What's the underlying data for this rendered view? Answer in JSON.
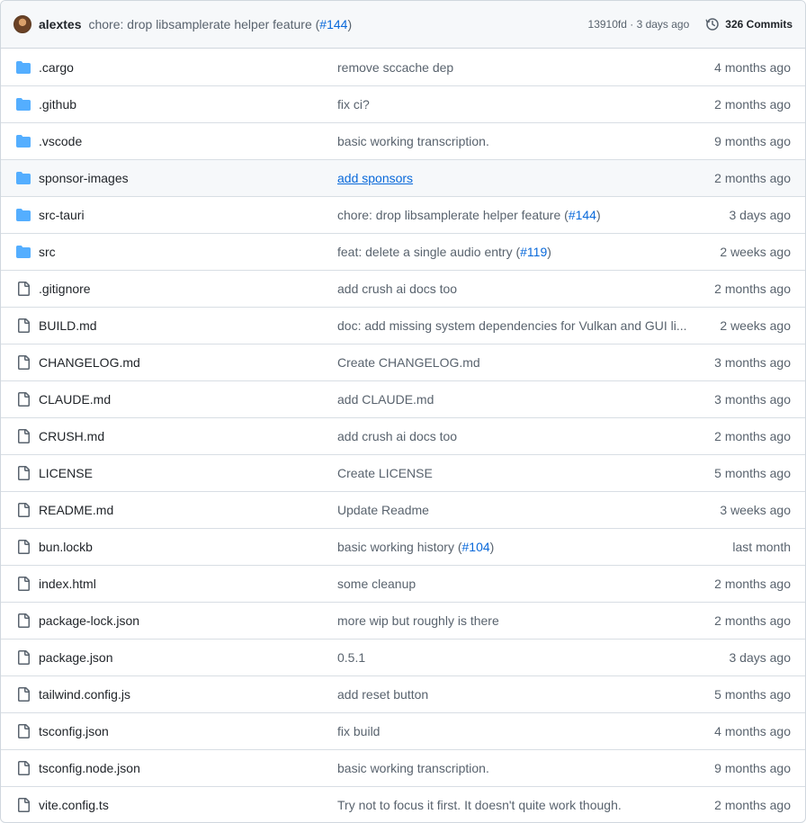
{
  "latest_commit": {
    "author": "alextes",
    "message": "chore: drop libsamplerate helper feature (",
    "pr": "#144",
    "message_end": ")",
    "meta": "13910fd · 3 days ago",
    "commits_label": "326 Commits"
  },
  "colors": {
    "folder": "#54aeff",
    "link": "#0969da",
    "muted": "#59636e"
  },
  "files": [
    {
      "name": ".cargo",
      "type": "folder",
      "msg": "remove sccache dep",
      "pr": "",
      "msg_end": "",
      "time": "4 months ago"
    },
    {
      "name": ".github",
      "type": "folder",
      "msg": "fix ci?",
      "pr": "",
      "msg_end": "",
      "time": "2 months ago"
    },
    {
      "name": ".vscode",
      "type": "folder",
      "msg": "basic working transcription.",
      "pr": "",
      "msg_end": "",
      "time": "9 months ago"
    },
    {
      "name": "sponsor-images",
      "type": "folder",
      "msg": "add sponsors",
      "pr": "",
      "msg_end": "",
      "time": "2 months ago",
      "hover": true
    },
    {
      "name": "src-tauri",
      "type": "folder",
      "msg": "chore: drop libsamplerate helper feature (",
      "pr": "#144",
      "msg_end": ")",
      "time": "3 days ago"
    },
    {
      "name": "src",
      "type": "folder",
      "msg": "feat: delete a single audio entry (",
      "pr": "#119",
      "msg_end": ")",
      "time": "2 weeks ago"
    },
    {
      "name": ".gitignore",
      "type": "file",
      "msg": "add crush ai docs too",
      "pr": "",
      "msg_end": "",
      "time": "2 months ago"
    },
    {
      "name": "BUILD.md",
      "type": "file",
      "msg": "doc: add missing system dependencies for Vulkan and GUI li...",
      "pr": "",
      "msg_end": "",
      "time": "2 weeks ago"
    },
    {
      "name": "CHANGELOG.md",
      "type": "file",
      "msg": "Create CHANGELOG.md",
      "pr": "",
      "msg_end": "",
      "time": "3 months ago"
    },
    {
      "name": "CLAUDE.md",
      "type": "file",
      "msg": "add CLAUDE.md",
      "pr": "",
      "msg_end": "",
      "time": "3 months ago"
    },
    {
      "name": "CRUSH.md",
      "type": "file",
      "msg": "add crush ai docs too",
      "pr": "",
      "msg_end": "",
      "time": "2 months ago"
    },
    {
      "name": "LICENSE",
      "type": "file",
      "msg": "Create LICENSE",
      "pr": "",
      "msg_end": "",
      "time": "5 months ago"
    },
    {
      "name": "README.md",
      "type": "file",
      "msg": "Update Readme",
      "pr": "",
      "msg_end": "",
      "time": "3 weeks ago"
    },
    {
      "name": "bun.lockb",
      "type": "file",
      "msg": "basic working history (",
      "pr": "#104",
      "msg_end": ")",
      "time": "last month"
    },
    {
      "name": "index.html",
      "type": "file",
      "msg": "some cleanup",
      "pr": "",
      "msg_end": "",
      "time": "2 months ago"
    },
    {
      "name": "package-lock.json",
      "type": "file",
      "msg": "more wip but roughly is there",
      "pr": "",
      "msg_end": "",
      "time": "2 months ago"
    },
    {
      "name": "package.json",
      "type": "file",
      "msg": "0.5.1",
      "pr": "",
      "msg_end": "",
      "time": "3 days ago"
    },
    {
      "name": "tailwind.config.js",
      "type": "file",
      "msg": "add reset button",
      "pr": "",
      "msg_end": "",
      "time": "5 months ago"
    },
    {
      "name": "tsconfig.json",
      "type": "file",
      "msg": "fix build",
      "pr": "",
      "msg_end": "",
      "time": "4 months ago"
    },
    {
      "name": "tsconfig.node.json",
      "type": "file",
      "msg": "basic working transcription.",
      "pr": "",
      "msg_end": "",
      "time": "9 months ago"
    },
    {
      "name": "vite.config.ts",
      "type": "file",
      "msg": "Try not to focus it first. It doesn't quite work though.",
      "pr": "",
      "msg_end": "",
      "time": "2 months ago"
    }
  ]
}
